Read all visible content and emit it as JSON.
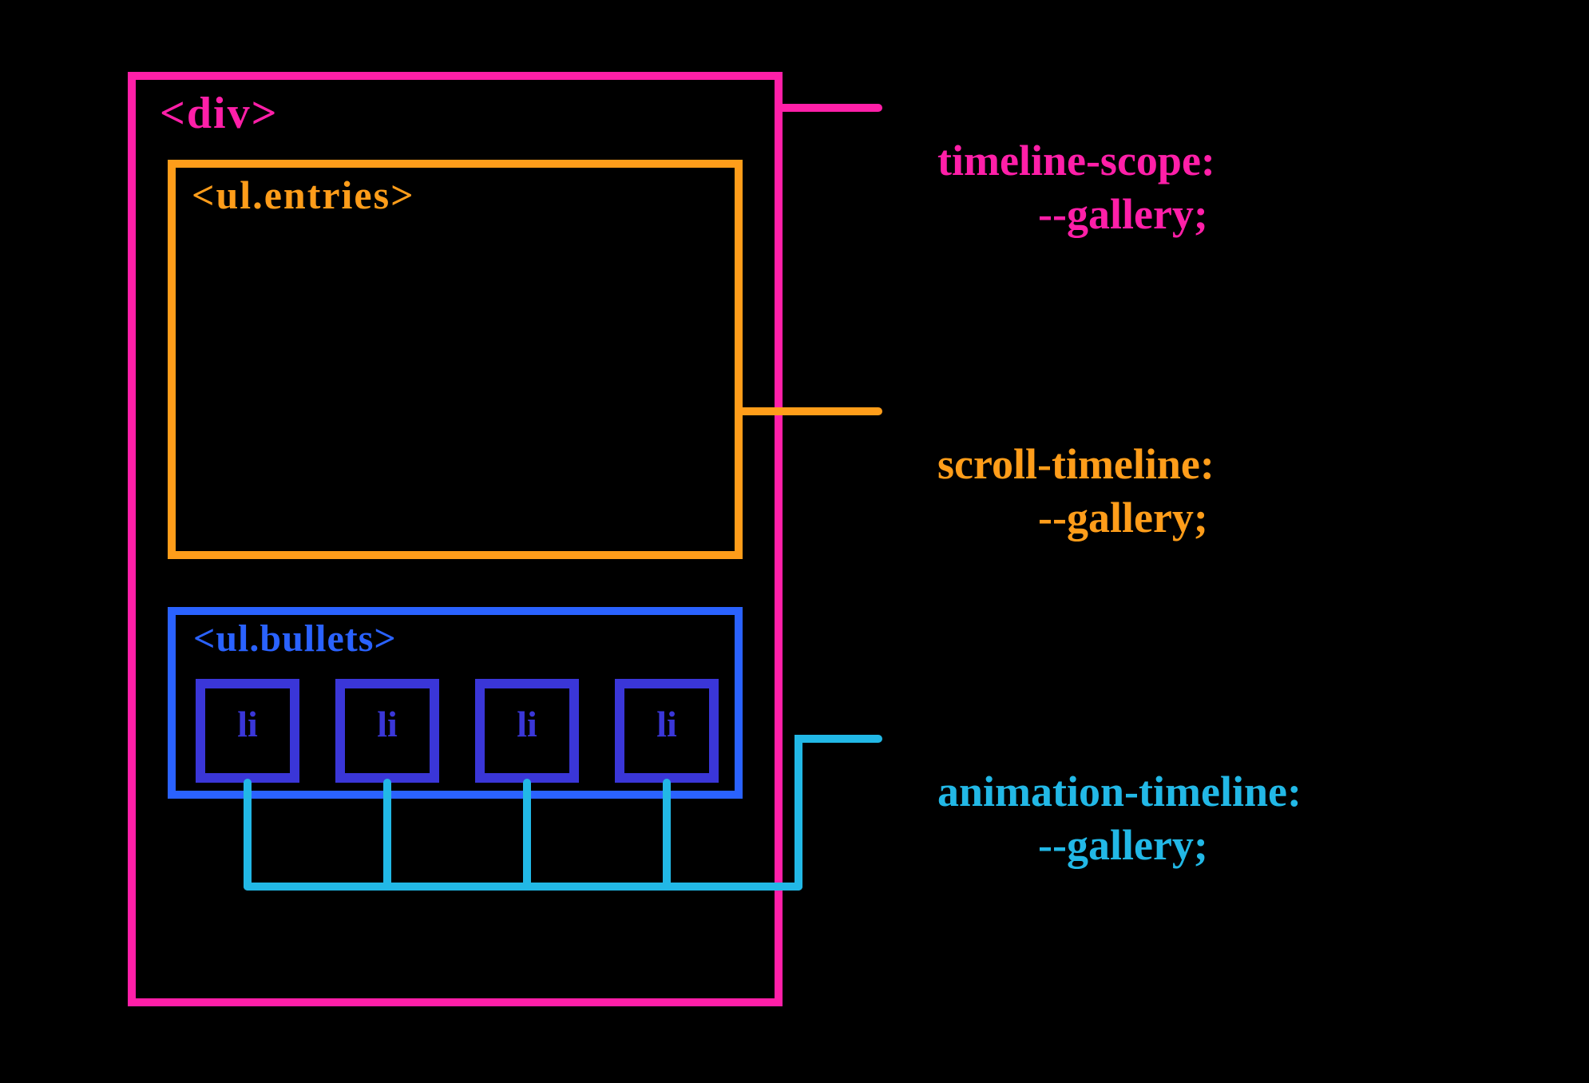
{
  "colors": {
    "magenta": "#ff1fa8",
    "orange": "#ff9d1a",
    "blue": "#2a62ff",
    "indigo": "#3a36d8",
    "cyan": "#22b8e6"
  },
  "boxes": {
    "outer": {
      "tag": "<div>"
    },
    "entries": {
      "tag": "<ul.entries>"
    },
    "bullets": {
      "tag": "<ul.bullets>"
    },
    "li_items": [
      "li",
      "li",
      "li",
      "li"
    ]
  },
  "annotations": {
    "timeline_scope": {
      "line1": "timeline-scope:",
      "line2": "--gallery;"
    },
    "scroll_timeline": {
      "line1": "scroll-timeline:",
      "line2": "--gallery;"
    },
    "animation_timeline": {
      "line1": "animation-timeline:",
      "line2": "--gallery;"
    }
  }
}
